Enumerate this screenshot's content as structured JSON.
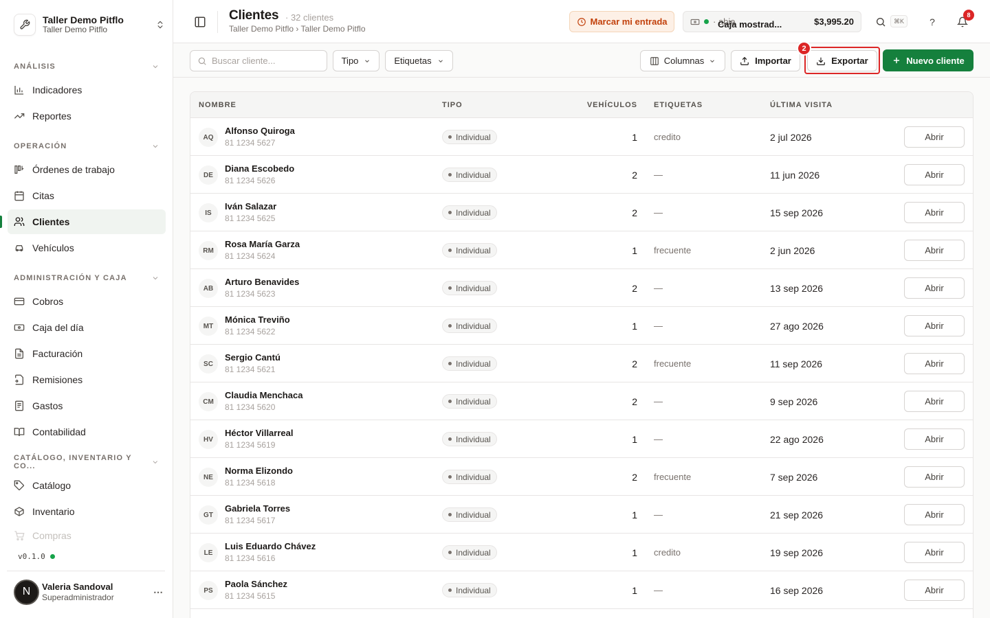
{
  "workspace": {
    "name": "Taller Demo Pitflo",
    "subtitle": "Taller Demo Pitflo"
  },
  "sidebar": {
    "sections": [
      {
        "label": "ANÁLISIS"
      },
      {
        "label": "OPERACIÓN"
      },
      {
        "label": "ADMINISTRACIÓN Y CAJA"
      },
      {
        "label": "CATÁLOGO, INVENTARIO Y CO..."
      }
    ],
    "items": [
      {
        "label": "Indicadores",
        "icon": "bar-chart-icon"
      },
      {
        "label": "Reportes",
        "icon": "trend-up-icon"
      },
      {
        "label": "Órdenes de trabajo",
        "icon": "work-order-icon"
      },
      {
        "label": "Citas",
        "icon": "calendar-icon"
      },
      {
        "label": "Clientes",
        "icon": "users-icon",
        "active": true
      },
      {
        "label": "Vehículos",
        "icon": "car-icon"
      },
      {
        "label": "Cobros",
        "icon": "card-icon"
      },
      {
        "label": "Caja del día",
        "icon": "cash-icon"
      },
      {
        "label": "Facturación",
        "icon": "invoice-icon"
      },
      {
        "label": "Remisiones",
        "icon": "file-export-icon"
      },
      {
        "label": "Gastos",
        "icon": "receipt-icon"
      },
      {
        "label": "Contabilidad",
        "icon": "book-icon"
      },
      {
        "label": "Catálogo",
        "icon": "tag-icon"
      },
      {
        "label": "Inventario",
        "icon": "box-icon"
      },
      {
        "label": "Compras",
        "icon": "cart-icon"
      }
    ],
    "version": "v0.1.0",
    "user": {
      "initial": "N",
      "name": "Valeria Sandoval",
      "role": "Superadministrador"
    }
  },
  "header": {
    "title": "Clientes",
    "count": "· 32 clientes",
    "breadcrumb": "Taller Demo Pitflo › Taller Demo Pitflo",
    "mark_entry": "Marcar mi entrada",
    "caja": {
      "name": "Caja mostrad...",
      "status": "· abie",
      "amount": "$3,995.20"
    },
    "shortcut": "⌘K",
    "notifications": "8"
  },
  "toolbar": {
    "search_placeholder": "Buscar cliente...",
    "tipo": "Tipo",
    "etiquetas": "Etiquetas",
    "columnas": "Columnas",
    "importar": "Importar",
    "exportar": "Exportar",
    "step_badge": "2",
    "nuevo": "Nuevo cliente"
  },
  "table": {
    "columns": [
      "NOMBRE",
      "TIPO",
      "VEHÍCULOS",
      "ETIQUETAS",
      "ÚLTIMA VISITA"
    ],
    "open_label": "Abrir",
    "rows": [
      {
        "initials": "AQ",
        "name": "Alfonso Quiroga",
        "phone": "81 1234 5627",
        "type": "Individual",
        "vehicles": "1",
        "tags": "credito",
        "last_visit": "2 jul 2026"
      },
      {
        "initials": "DE",
        "name": "Diana Escobedo",
        "phone": "81 1234 5626",
        "type": "Individual",
        "vehicles": "2",
        "tags": "—",
        "last_visit": "11 jun 2026"
      },
      {
        "initials": "IS",
        "name": "Iván Salazar",
        "phone": "81 1234 5625",
        "type": "Individual",
        "vehicles": "2",
        "tags": "—",
        "last_visit": "15 sep 2026"
      },
      {
        "initials": "RM",
        "name": "Rosa María Garza",
        "phone": "81 1234 5624",
        "type": "Individual",
        "vehicles": "1",
        "tags": "frecuente",
        "last_visit": "2 jun 2026"
      },
      {
        "initials": "AB",
        "name": "Arturo Benavides",
        "phone": "81 1234 5623",
        "type": "Individual",
        "vehicles": "2",
        "tags": "—",
        "last_visit": "13 sep 2026"
      },
      {
        "initials": "MT",
        "name": "Mónica Treviño",
        "phone": "81 1234 5622",
        "type": "Individual",
        "vehicles": "1",
        "tags": "—",
        "last_visit": "27 ago 2026"
      },
      {
        "initials": "SC",
        "name": "Sergio Cantú",
        "phone": "81 1234 5621",
        "type": "Individual",
        "vehicles": "2",
        "tags": "frecuente",
        "last_visit": "11 sep 2026"
      },
      {
        "initials": "CM",
        "name": "Claudia Menchaca",
        "phone": "81 1234 5620",
        "type": "Individual",
        "vehicles": "2",
        "tags": "—",
        "last_visit": "9 sep 2026"
      },
      {
        "initials": "HV",
        "name": "Héctor Villarreal",
        "phone": "81 1234 5619",
        "type": "Individual",
        "vehicles": "1",
        "tags": "—",
        "last_visit": "22 ago 2026"
      },
      {
        "initials": "NE",
        "name": "Norma Elizondo",
        "phone": "81 1234 5618",
        "type": "Individual",
        "vehicles": "2",
        "tags": "frecuente",
        "last_visit": "7 sep 2026"
      },
      {
        "initials": "GT",
        "name": "Gabriela Torres",
        "phone": "81 1234 5617",
        "type": "Individual",
        "vehicles": "1",
        "tags": "—",
        "last_visit": "21 sep 2026"
      },
      {
        "initials": "LE",
        "name": "Luis Eduardo Chávez",
        "phone": "81 1234 5616",
        "type": "Individual",
        "vehicles": "1",
        "tags": "credito",
        "last_visit": "19 sep 2026"
      },
      {
        "initials": "PS",
        "name": "Paola Sánchez",
        "phone": "81 1234 5615",
        "type": "Individual",
        "vehicles": "1",
        "tags": "—",
        "last_visit": "16 sep 2026"
      }
    ]
  },
  "colors": {
    "accent": "#15803d",
    "highlight": "#dc2626",
    "warning": "#c2410c"
  }
}
